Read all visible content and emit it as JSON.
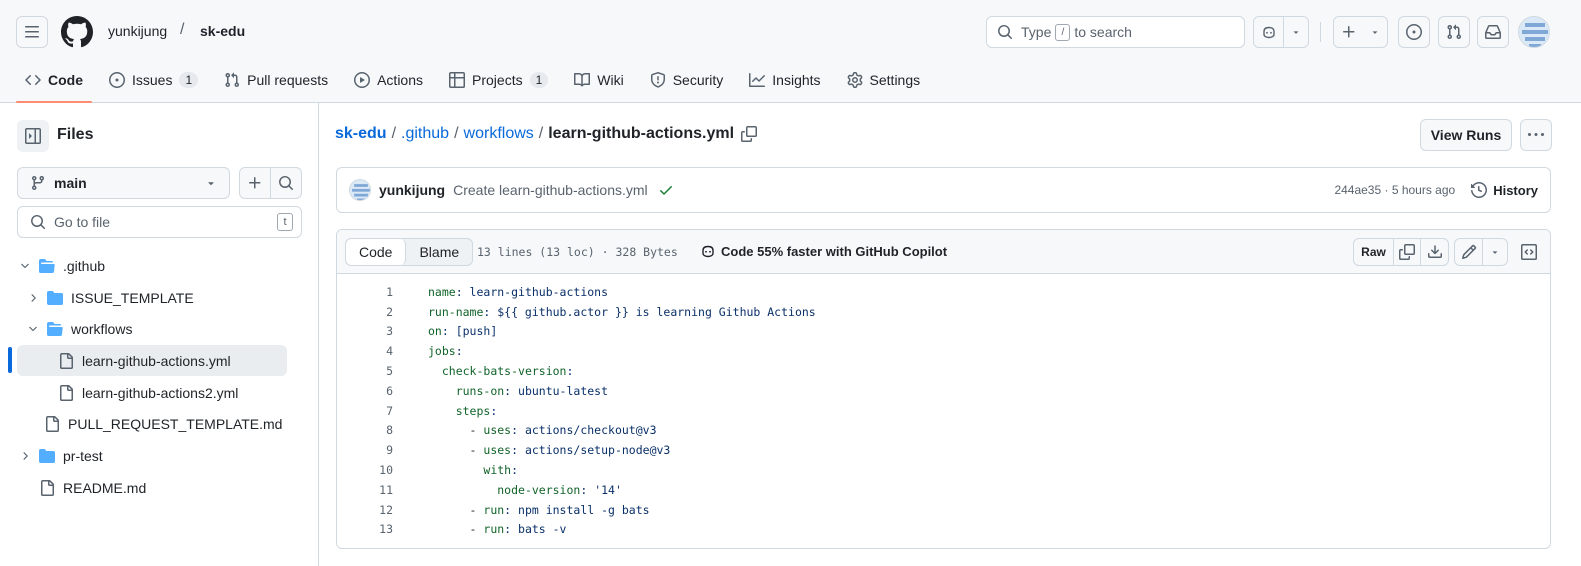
{
  "header": {
    "owner": "yunkijung",
    "separator": "/",
    "repo": "sk-edu",
    "search_prefix": "Type",
    "search_key": "/",
    "search_suffix": "to search"
  },
  "tabs": [
    {
      "label": "Code",
      "icon": "code-icon",
      "selected": true
    },
    {
      "label": "Issues",
      "icon": "issue-opened-icon",
      "count": "1"
    },
    {
      "label": "Pull requests",
      "icon": "git-pull-request-icon"
    },
    {
      "label": "Actions",
      "icon": "play-icon"
    },
    {
      "label": "Projects",
      "icon": "table-icon",
      "count": "1"
    },
    {
      "label": "Wiki",
      "icon": "book-icon"
    },
    {
      "label": "Security",
      "icon": "shield-icon"
    },
    {
      "label": "Insights",
      "icon": "graph-icon"
    },
    {
      "label": "Settings",
      "icon": "gear-icon"
    }
  ],
  "sidebar": {
    "title": "Files",
    "branch": "main",
    "goto_placeholder": "Go to file",
    "goto_key": "t",
    "tree": [
      {
        "name": ".github",
        "type": "folder",
        "expanded": true
      },
      {
        "name": "ISSUE_TEMPLATE",
        "type": "folder",
        "expanded": false
      },
      {
        "name": "workflows",
        "type": "folder",
        "expanded": true
      },
      {
        "name": "learn-github-actions.yml",
        "type": "file",
        "active": true
      },
      {
        "name": "learn-github-actions2.yml",
        "type": "file"
      },
      {
        "name": "PULL_REQUEST_TEMPLATE.md",
        "type": "file"
      },
      {
        "name": "pr-test",
        "type": "folder",
        "expanded": false
      },
      {
        "name": "README.md",
        "type": "file"
      }
    ]
  },
  "breadcrumb": {
    "repo": "sk-edu",
    "dir1": ".github",
    "dir2": "workflows",
    "file": "learn-github-actions.yml",
    "sep": "/"
  },
  "actions": {
    "view_runs": "View Runs"
  },
  "commit": {
    "author": "yunkijung",
    "message": "Create learn-github-actions.yml",
    "meta": "244ae35 · 5 hours ago",
    "history_label": "History"
  },
  "file_header": {
    "code_tab": "Code",
    "blame_tab": "Blame",
    "stats": "13 lines (13 loc) · 328 Bytes",
    "copilot": "Code 55% faster with GitHub Copilot",
    "raw": "Raw"
  },
  "code_lines": [
    {
      "n": "1",
      "text": "name: learn-github-actions"
    },
    {
      "n": "2",
      "text": "run-name: ${{ github.actor }} is learning Github Actions"
    },
    {
      "n": "3",
      "text": "on: [push]"
    },
    {
      "n": "4",
      "text": "jobs:"
    },
    {
      "n": "5",
      "text": "  check-bats-version:"
    },
    {
      "n": "6",
      "text": "    runs-on: ubuntu-latest"
    },
    {
      "n": "7",
      "text": "    steps:"
    },
    {
      "n": "8",
      "text": "      - uses: actions/checkout@v3"
    },
    {
      "n": "9",
      "text": "      - uses: actions/setup-node@v3"
    },
    {
      "n": "10",
      "text": "        with:"
    },
    {
      "n": "11",
      "text": "          node-version: '14'"
    },
    {
      "n": "12",
      "text": "      - run: npm install -g bats"
    },
    {
      "n": "13",
      "text": "      - run: bats -v"
    }
  ],
  "colors": {
    "accent": "#0969da",
    "selected_underline": "#fd8c73",
    "folder": "#54aeff",
    "success": "#1a7f37",
    "yaml_key": "#116329",
    "yaml_value": "#0a3069"
  }
}
